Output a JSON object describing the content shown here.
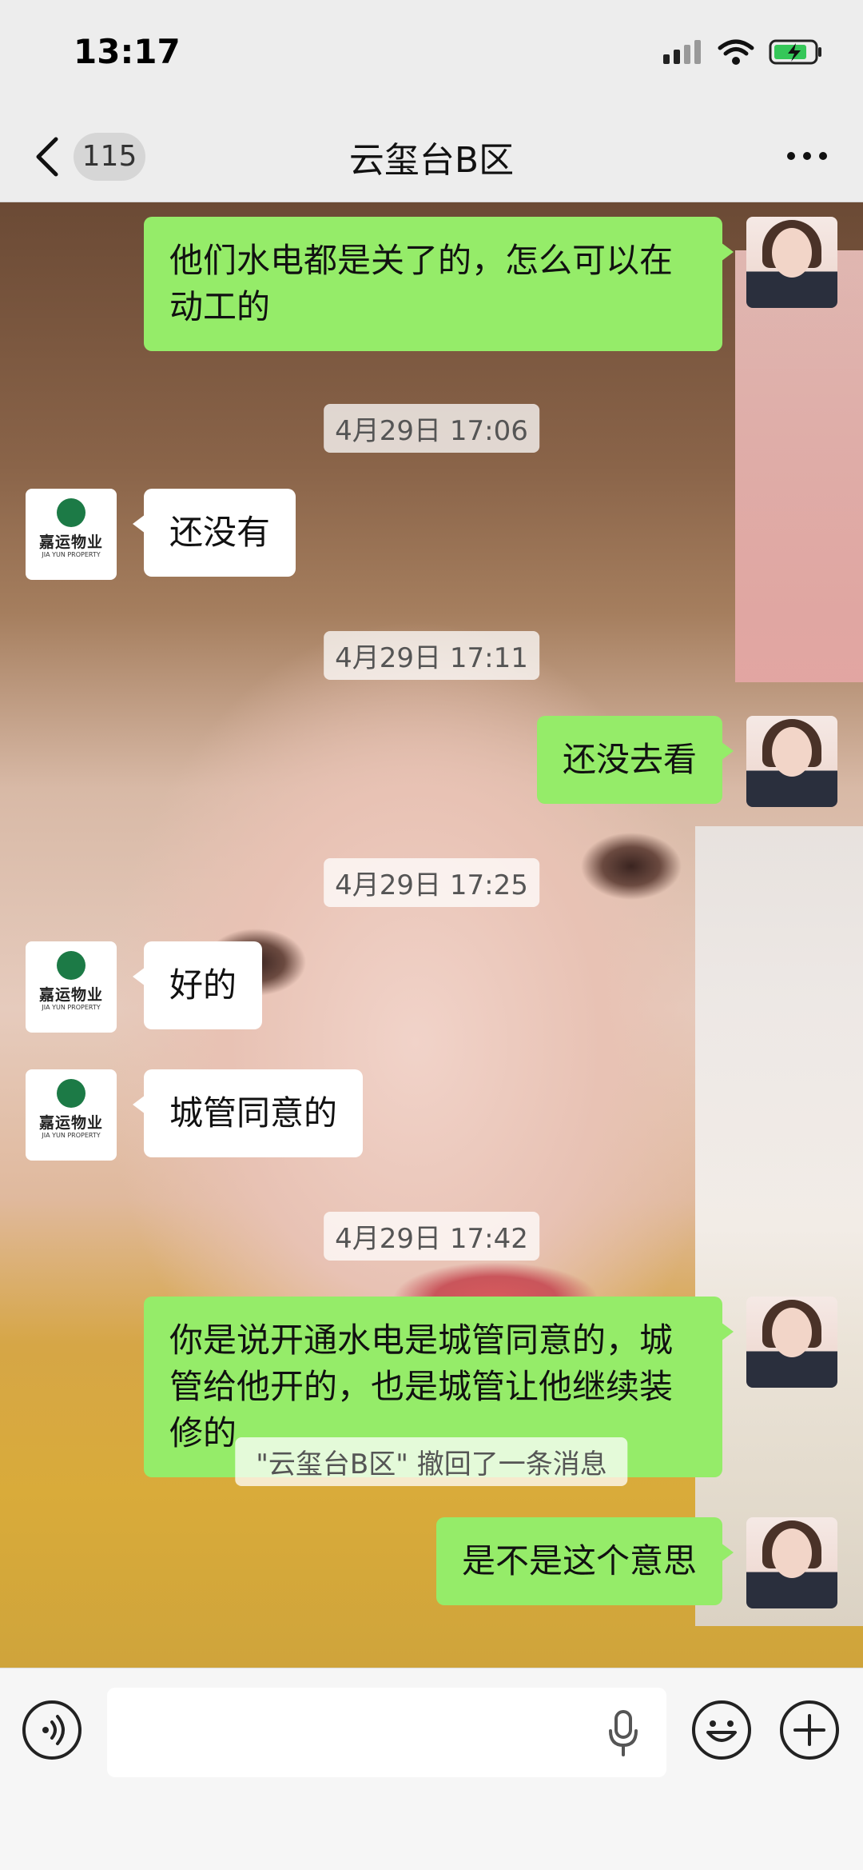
{
  "status_bar": {
    "time": "13:17"
  },
  "header": {
    "back_count": "115",
    "title": "云玺台B区",
    "more": "more"
  },
  "messages": [
    {
      "side": "out",
      "text": "他们水电都是关了的，怎么可以在动工的"
    },
    {
      "time": "4月29日 17:06"
    },
    {
      "side": "in",
      "text": "还没有"
    },
    {
      "time": "4月29日 17:11"
    },
    {
      "side": "out",
      "text": "还没去看"
    },
    {
      "time": "4月29日 17:25"
    },
    {
      "side": "in",
      "text": "好的"
    },
    {
      "side": "in",
      "text": "城管同意的"
    },
    {
      "time": "4月29日 17:42"
    },
    {
      "side": "out",
      "text": "你是说开通水电是城管同意的，城管给他开的，也是城管让他继续装修的"
    },
    {
      "side": "out",
      "text": "是不是这个意思"
    }
  ],
  "recall_notice": "\"云玺台B区\" 撤回了一条消息",
  "contact_logo": {
    "name": "嘉运物业",
    "sub": "JIA YUN PROPERTY"
  },
  "icons": {
    "back": "chevron-left-icon",
    "more": "more-dots-icon",
    "voice": "voice-icon",
    "mic": "microphone-icon",
    "emoji": "emoji-icon",
    "plus": "plus-icon"
  }
}
